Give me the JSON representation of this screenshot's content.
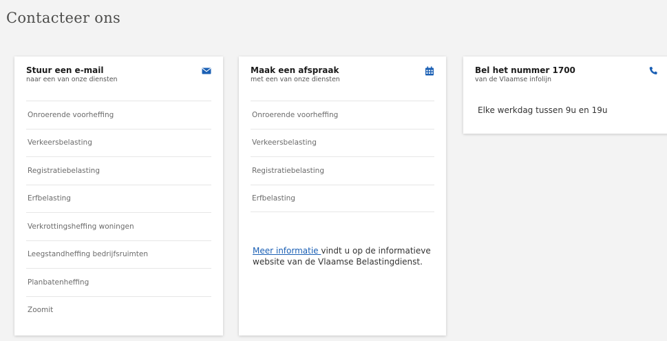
{
  "page": {
    "title": "Contacteer ons"
  },
  "colors": {
    "accent": "#1a5fb4",
    "card_bg": "#ffffff",
    "page_bg": "#f3f3f3"
  },
  "email_card": {
    "title": "Stuur een e-mail",
    "subtitle": "naar een van onze diensten",
    "icon": "envelope-icon",
    "items": [
      "Onroerende voorheffing",
      "Verkeersbelasting",
      "Registratiebelasting",
      "Erfbelasting",
      "Verkrottingsheffing woningen",
      "Leegstandheffing bedrijfsruimten",
      "Planbatenheffing",
      "Zoomit"
    ]
  },
  "afspraak_card": {
    "title": "Maak een afspraak",
    "subtitle": "met een van onze diensten",
    "icon": "calendar-icon",
    "items": [
      "Onroerende voorheffing",
      "Verkeersbelasting",
      "Registratiebelasting",
      "Erfbelasting"
    ],
    "info_link": "Meer informatie ",
    "info_text": "vindt u op de informatieve website van de Vlaamse Belastingdienst."
  },
  "bel_card": {
    "title": "Bel het nummer 1700",
    "subtitle": "van de Vlaamse infolijn",
    "icon": "phone-icon",
    "hours": "Elke werkdag tussen 9u en 19u"
  }
}
